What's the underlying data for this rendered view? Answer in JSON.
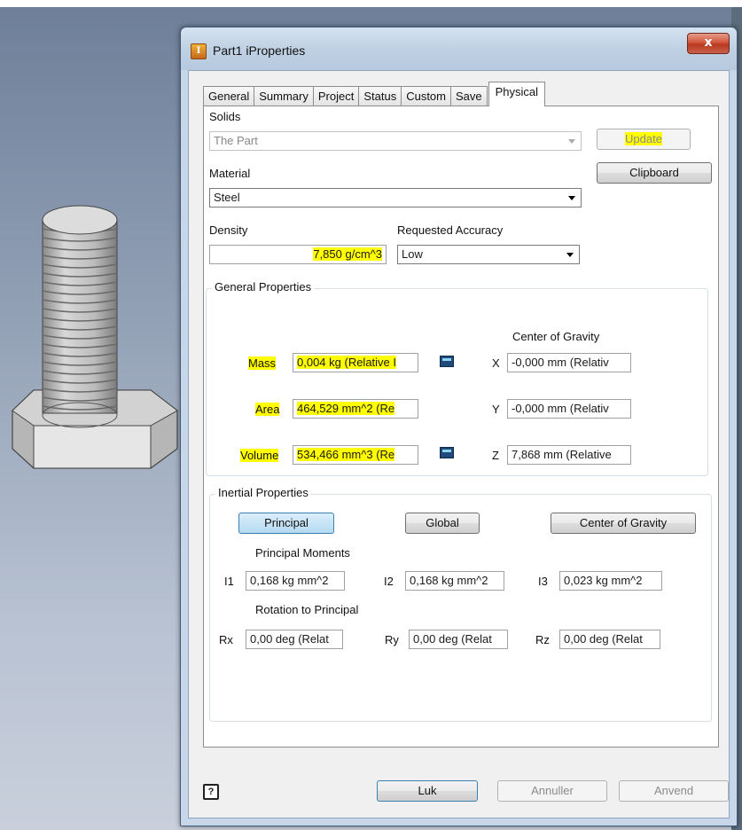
{
  "window": {
    "title": "Part1 iProperties",
    "close_glyph": "x"
  },
  "tabs": [
    "General",
    "Summary",
    "Project",
    "Status",
    "Custom",
    "Save",
    "Physical"
  ],
  "physical": {
    "solids_label": "Solids",
    "solids_value": "The Part",
    "update_button": "Update",
    "clipboard_button": "Clipboard",
    "material_label": "Material",
    "material_value": "Steel",
    "density_label": "Density",
    "density_value": "7,850 g/cm^3",
    "accuracy_label": "Requested Accuracy",
    "accuracy_value": "Low"
  },
  "general_properties": {
    "title": "General Properties",
    "cog_header": "Center of Gravity",
    "mass_label": "Mass",
    "mass_value": "0,004 kg (Relative I",
    "area_label": "Area",
    "area_value": "464,529 mm^2 (Re",
    "volume_label": "Volume",
    "volume_value": "534,466 mm^3 (Re",
    "x_label": "X",
    "x_value": "-0,000 mm (Relativ",
    "y_label": "Y",
    "y_value": "-0,000 mm (Relativ",
    "z_label": "Z",
    "z_value": "7,868 mm (Relative"
  },
  "inertial_properties": {
    "title": "Inertial Properties",
    "principal_button": "Principal",
    "global_button": "Global",
    "cog_button": "Center of Gravity",
    "moments_label": "Principal Moments",
    "i1_label": "I1",
    "i1_value": "0,168 kg mm^2",
    "i2_label": "I2",
    "i2_value": "0,168 kg mm^2",
    "i3_label": "I3",
    "i3_value": "0,023 kg mm^2",
    "rotation_label": "Rotation to Principal",
    "rx_label": "Rx",
    "rx_value": "0,00 deg (Relat",
    "ry_label": "Ry",
    "ry_value": "0,00 deg (Relat",
    "rz_label": "Rz",
    "rz_value": "0,00 deg (Relat"
  },
  "footer": {
    "help_glyph": "?",
    "ok_button": "Luk",
    "cancel_button": "Annuller",
    "apply_button": "Anvend"
  },
  "colors": {
    "highlight": "#ffff00",
    "title_bar": "#c7d6e8",
    "close": "#c9503a"
  }
}
